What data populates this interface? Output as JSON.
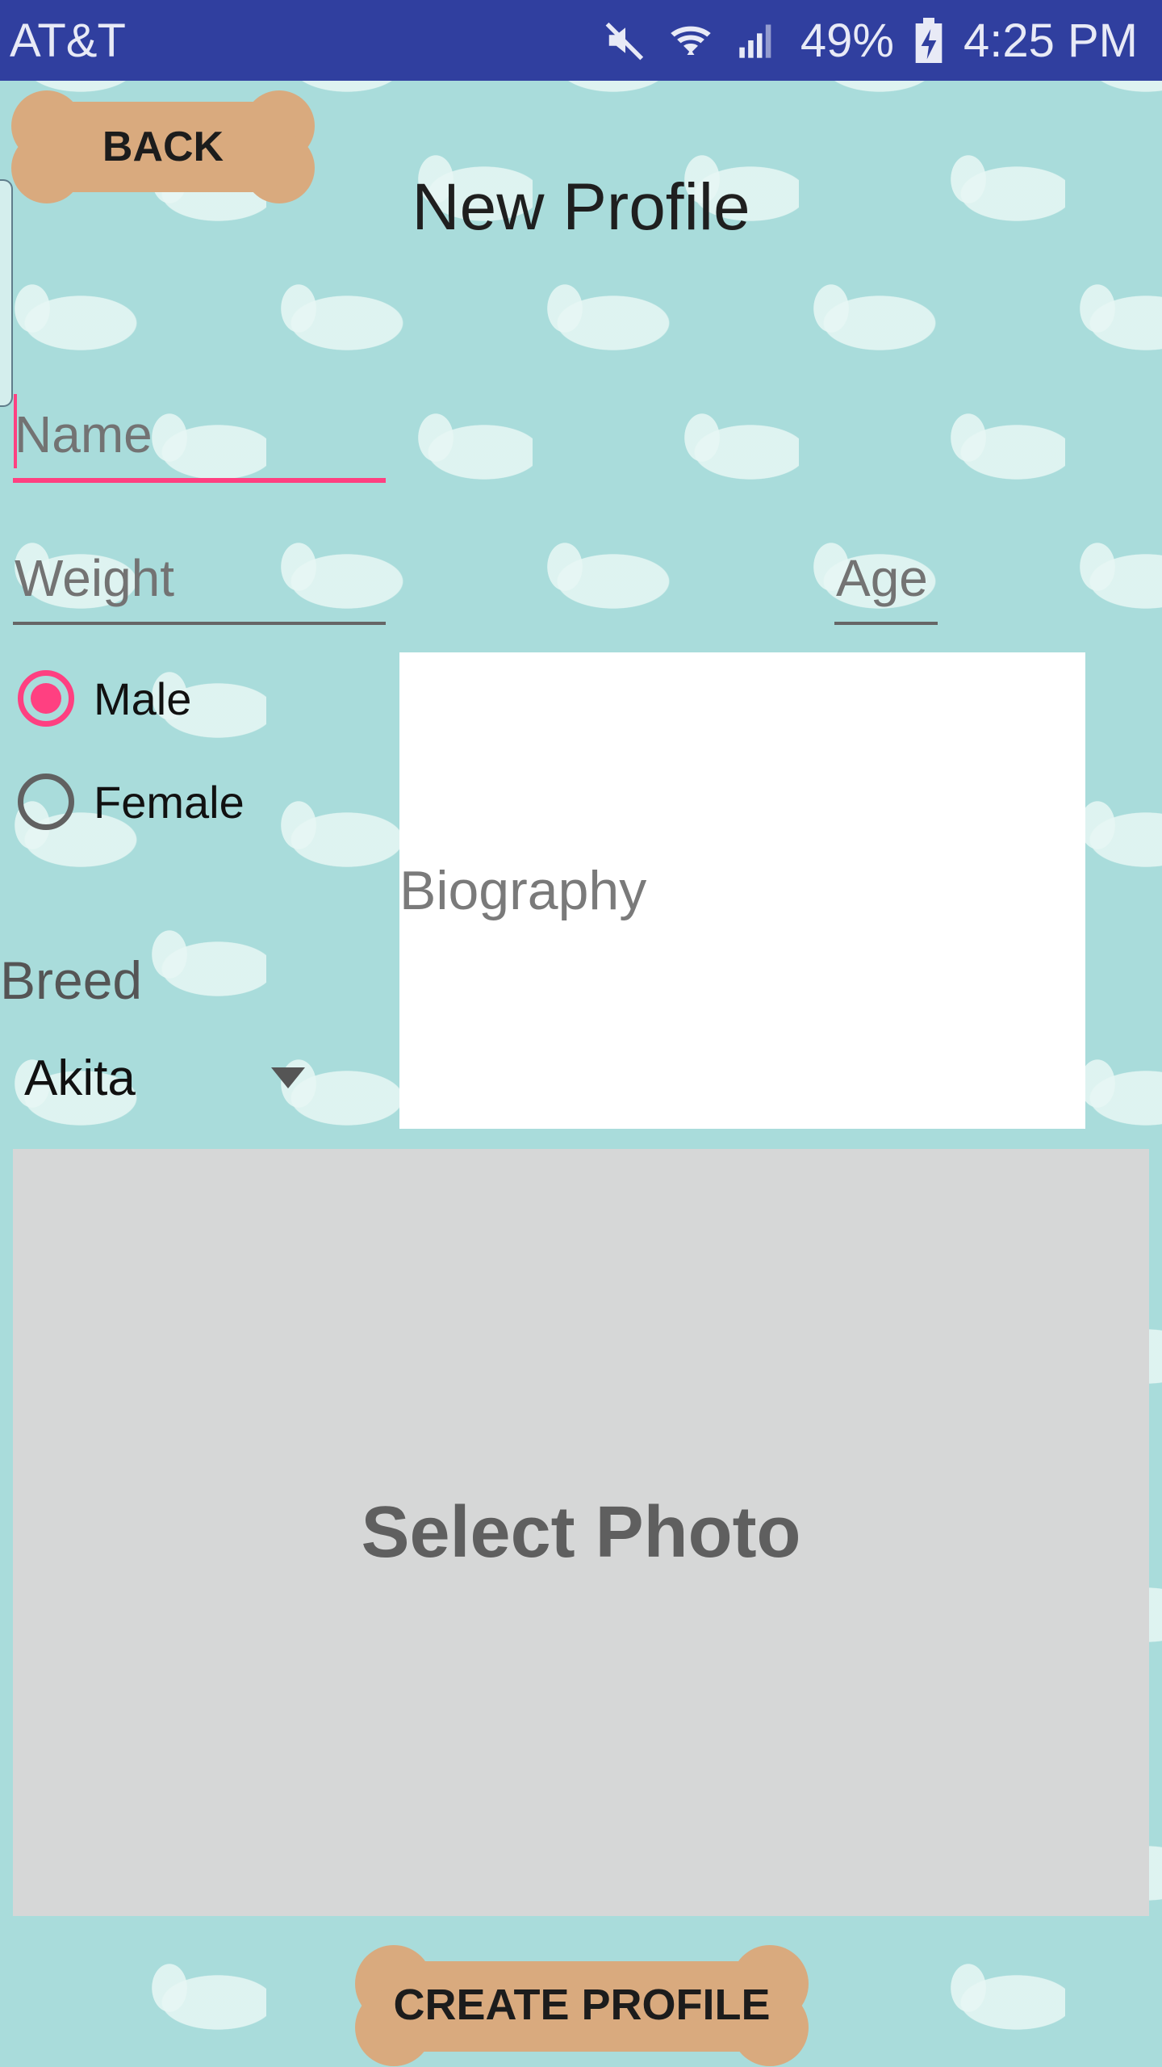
{
  "status_bar": {
    "carrier": "AT&T",
    "battery": "49%",
    "time": "4:25 PM",
    "icons": [
      "mute-icon",
      "wifi-icon",
      "signal-icon",
      "battery-charging-icon"
    ],
    "background_color": "#303f9f"
  },
  "header": {
    "back_label": "BACK",
    "title": "New Profile"
  },
  "form": {
    "name_placeholder": "Name",
    "name_value": "",
    "weight_placeholder": "Weight",
    "weight_value": "",
    "age_placeholder": "Age",
    "age_value": "",
    "sex_options": [
      {
        "label": "Male",
        "selected": true
      },
      {
        "label": "Female",
        "selected": false
      }
    ],
    "biography_placeholder": "Biography",
    "breed_label": "Breed",
    "breed_value": "Akita"
  },
  "photo": {
    "label": "Select Photo"
  },
  "footer": {
    "create_label": "CREATE PROFILE"
  },
  "colors": {
    "accent": "#ff4081",
    "bone": "#d9aa7e",
    "background": "#a9dcdb",
    "photo_box": "#d6d7d7"
  }
}
